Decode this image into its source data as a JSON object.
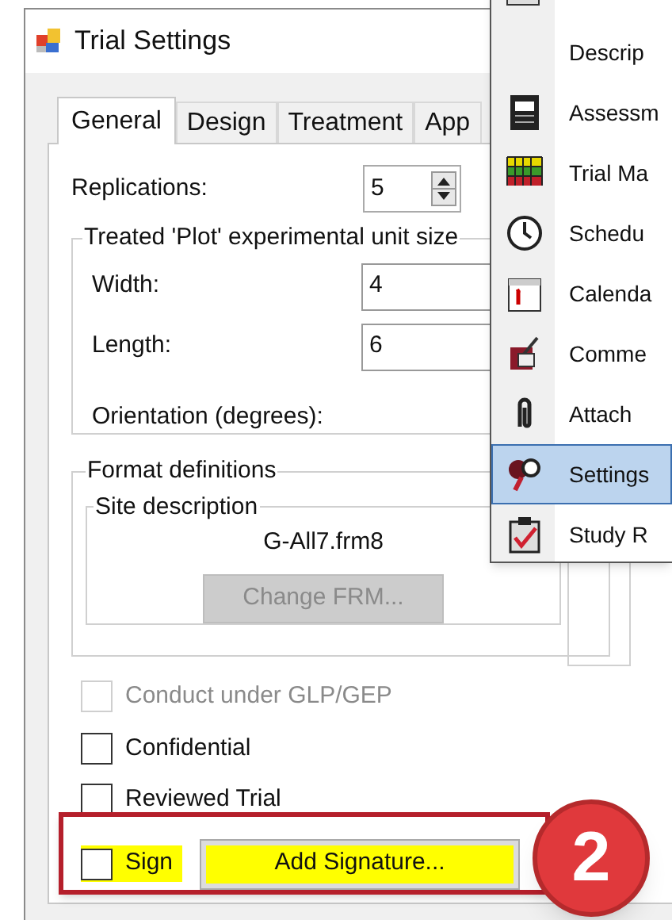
{
  "window": {
    "title": "Trial Settings"
  },
  "tabs": [
    {
      "label": "General",
      "selected": true
    },
    {
      "label": "Design",
      "selected": false
    },
    {
      "label": "Treatment",
      "selected": false
    },
    {
      "label": "App",
      "selected": false
    }
  ],
  "replications": {
    "label": "Replications:",
    "value": "5"
  },
  "plot_group": {
    "title": "Treated 'Plot' experimental unit size",
    "fields": [
      {
        "label": "Width:",
        "value": "4"
      },
      {
        "label": "Length:",
        "value": "6"
      }
    ],
    "orientation_label": "Orientation (degrees):"
  },
  "format_group": {
    "title": "Format definitions",
    "site_group": {
      "title": "Site description",
      "file": "G-All7.frm8",
      "button": "Change FRM..."
    }
  },
  "checkboxes": [
    {
      "label": "Conduct under GLP/GEP",
      "checked": false,
      "disabled": true
    },
    {
      "label": "Confidential",
      "checked": false,
      "disabled": false
    },
    {
      "label": "Reviewed Trial",
      "checked": false,
      "disabled": false
    }
  ],
  "sign": {
    "label": "Sign",
    "checked": false,
    "button": "Add Signature..."
  },
  "annotation_badge": "2",
  "menu": {
    "items": [
      {
        "label": "Descrip",
        "selected": false
      },
      {
        "label": "Assessm",
        "selected": false
      },
      {
        "label": "Trial Ma",
        "selected": false
      },
      {
        "label": "Schedu",
        "selected": false
      },
      {
        "label": "Calenda",
        "selected": false
      },
      {
        "label": "Comme",
        "selected": false
      },
      {
        "label": "Attach",
        "selected": false
      },
      {
        "label": "Settings",
        "selected": true
      },
      {
        "label": "Study R",
        "selected": false
      }
    ]
  }
}
